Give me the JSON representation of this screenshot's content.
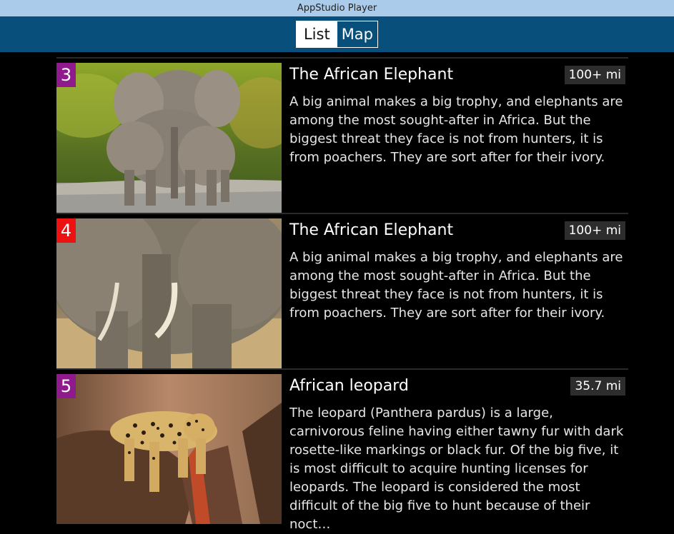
{
  "window": {
    "title": "AppStudio Player"
  },
  "toggle": {
    "list_label": "List",
    "map_label": "Map",
    "selected": "List"
  },
  "items": [
    {
      "rank": "3",
      "rank_color": "#8e1a8c",
      "distance": "100+ mi",
      "title": "The African Elephant",
      "description": "A big animal makes a big trophy, and elephants are among the most sought-after in Africa. But the biggest threat they face is not from hunters, it is from poachers. They are sort after for their ivory.",
      "image": "elephant-family-photo"
    },
    {
      "rank": "4",
      "rank_color": "#ee1111",
      "distance": "100+ mi",
      "title": "The African Elephant",
      "description": "A big animal makes a big trophy, and elephants are among the most sought-after in Africa. But the biggest threat they face is not from hunters, it is from poachers. They are sort after for their ivory.",
      "image": "elephant-closeup-photo"
    },
    {
      "rank": "5",
      "rank_color": "#8e1a8c",
      "distance": "35.7 mi",
      "title": "African leopard",
      "description": "The leopard (Panthera pardus) is a large, carnivorous feline having either tawny fur with dark rosette-like markings or black fur. Of the big five, it is most difficult to acquire hunting licenses for leopards. The leopard is considered the most difficult of the big five to hunt because of their noct…",
      "image": "leopard-on-branch-photo"
    }
  ]
}
